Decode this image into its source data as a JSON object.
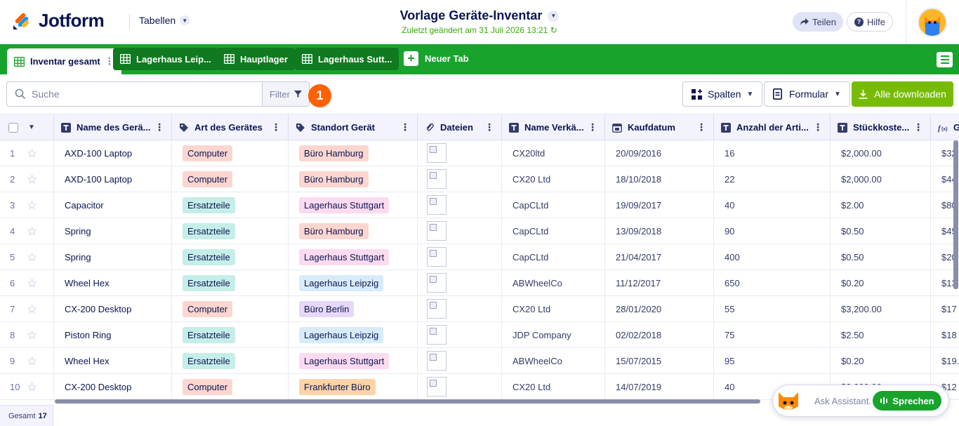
{
  "header": {
    "logo_text": "Jotform",
    "tables_label": "Tabellen",
    "doc_title": "Vorlage Geräte-Inventar",
    "last_modified": "Zuletzt geändert am 31 Juli 2026 13:21",
    "share_label": "Teilen",
    "help_label": "Hilfe"
  },
  "tabs": [
    {
      "label": "Inventar gesamt",
      "active": true
    },
    {
      "label": "Lagerhaus Leip...",
      "active": false
    },
    {
      "label": "Hauptlager",
      "active": false
    },
    {
      "label": "Lagerhaus Sutt...",
      "active": false
    }
  ],
  "new_tab_label": "Neuer Tab",
  "toolbar": {
    "search_placeholder": "Suche",
    "filter_label": "Filter",
    "badge": "1",
    "columns_label": "Spalten",
    "form_label": "Formular",
    "download_label": "Alle downloaden"
  },
  "columns": [
    {
      "label": "Name des Gerä...",
      "icon": "text-icon"
    },
    {
      "label": "Art des Gerätes",
      "icon": "tag-icon"
    },
    {
      "label": "Standort Gerät",
      "icon": "tag-icon"
    },
    {
      "label": "Dateien",
      "icon": "paperclip-icon"
    },
    {
      "label": "Name Verkä...",
      "icon": "text-icon"
    },
    {
      "label": "Kaufdatum",
      "icon": "calendar-icon"
    },
    {
      "label": "Anzahl der Arti...",
      "icon": "text-icon"
    },
    {
      "label": "Stückkoste...",
      "icon": "text-icon"
    },
    {
      "label": "G",
      "icon": "formula-icon"
    }
  ],
  "rows": [
    {
      "n": "1",
      "name": "AXD-100 Laptop",
      "type": "Computer",
      "loc": "Büro Hamburg",
      "vendor": "CX20ltd",
      "date": "20/09/2016",
      "qty": "16",
      "cost": "$2,000.00",
      "total": "$32"
    },
    {
      "n": "2",
      "name": "AXD-100 Laptop",
      "type": "Computer",
      "loc": "Büro Hamburg",
      "vendor": "CX20 Ltd",
      "date": "18/10/2018",
      "qty": "22",
      "cost": "$2,000.00",
      "total": "$44"
    },
    {
      "n": "3",
      "name": "Capacitor",
      "type": "Ersatzteile",
      "loc": "Lagerhaus Stuttgart",
      "vendor": "CapCLtd",
      "date": "19/09/2017",
      "qty": "40",
      "cost": "$2.00",
      "total": "$80"
    },
    {
      "n": "4",
      "name": "Spring",
      "type": "Ersatzteile",
      "loc": "Büro Hamburg",
      "vendor": "CapCLtd",
      "date": "13/09/2018",
      "qty": "90",
      "cost": "$0.50",
      "total": "$45"
    },
    {
      "n": "5",
      "name": "Spring",
      "type": "Ersatzteile",
      "loc": "Lagerhaus Stuttgart",
      "vendor": "CapCLtd",
      "date": "21/04/2017",
      "qty": "400",
      "cost": "$0.50",
      "total": "$20"
    },
    {
      "n": "6",
      "name": "Wheel Hex",
      "type": "Ersatzteile",
      "loc": "Lagerhaus Leipzig",
      "vendor": "ABWheelCo",
      "date": "11/12/2017",
      "qty": "650",
      "cost": "$0.20",
      "total": "$13"
    },
    {
      "n": "7",
      "name": "CX-200 Desktop",
      "type": "Computer",
      "loc": "Büro Berlin",
      "vendor": "CX20 Ltd",
      "date": "28/01/2020",
      "qty": "55",
      "cost": "$3,200.00",
      "total": "$17"
    },
    {
      "n": "8",
      "name": "Piston Ring",
      "type": "Ersatzteile",
      "loc": "Lagerhaus Leipzig",
      "vendor": "JDP Company",
      "date": "02/02/2018",
      "qty": "75",
      "cost": "$2.50",
      "total": "$18"
    },
    {
      "n": "9",
      "name": "Wheel Hex",
      "type": "Ersatzteile",
      "loc": "Lagerhaus Stuttgart",
      "vendor": "ABWheelCo",
      "date": "15/07/2015",
      "qty": "95",
      "cost": "$0.20",
      "total": "$19."
    },
    {
      "n": "10",
      "name": "CX-200 Desktop",
      "type": "Computer",
      "loc": "Frankfurter Büro",
      "vendor": "CX20 Ltd",
      "date": "14/07/2019",
      "qty": "40",
      "cost": "$3,200.00",
      "total": "$12"
    }
  ],
  "chip_colors": {
    "Computer": "#fdd6cf",
    "Ersatzteile": "#c5eee8",
    "Büro Hamburg": "#fdd6cf",
    "Lagerhaus Stuttgart": "#fcdaf0",
    "Lagerhaus Leipzig": "#d7ecfb",
    "Büro Berlin": "#e6d7fb",
    "Frankfurter Büro": "#fcd3a6"
  },
  "footer": {
    "total_label": "Gesamt",
    "total_count": "17"
  },
  "assistant": {
    "placeholder": "Ask Assistant...",
    "speak_label": "Sprechen"
  },
  "colors": {
    "brand_green": "#18a42c",
    "download_green": "#78bb07",
    "badge_orange": "#ff6100"
  }
}
